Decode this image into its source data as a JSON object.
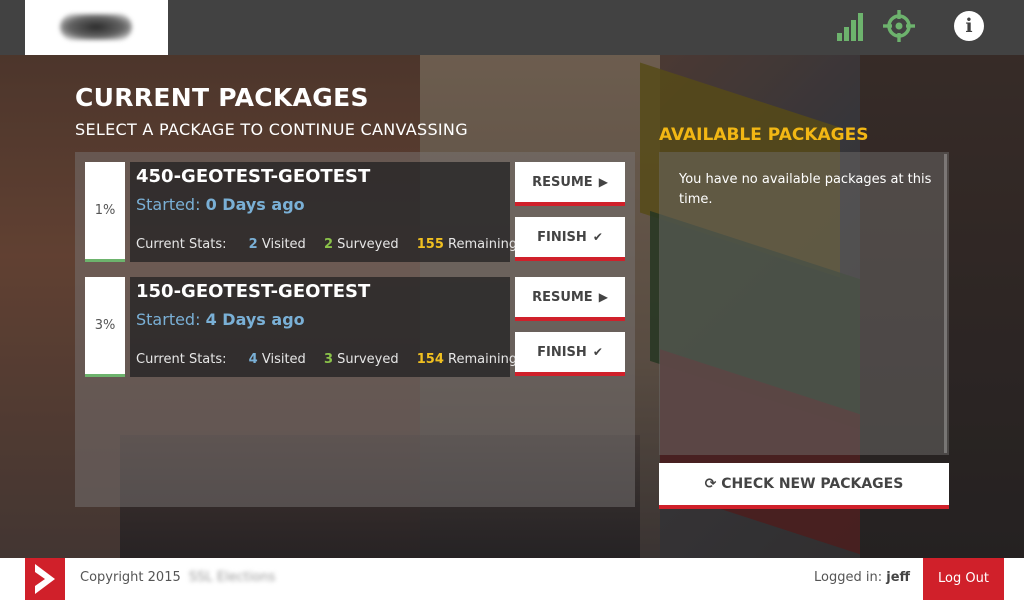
{
  "topbar": {
    "colors": {
      "icon_green": "#6db36d",
      "bar": "#424242"
    },
    "icons": [
      "signal-icon",
      "gps-target-icon",
      "info-icon"
    ]
  },
  "current": {
    "title": "CURRENT PACKAGES",
    "subtitle": "SELECT A PACKAGE TO CONTINUE CANVASSING",
    "stats_label": "Current Stats:",
    "started_label": "Started:",
    "visited_label": "Visited",
    "surveyed_label": "Surveyed",
    "remaining_label": "Remaining",
    "resume_label": "RESUME",
    "finish_label": "FINISH",
    "packages": [
      {
        "progress": "1%",
        "name": "450-GEOTEST-GEOTEST",
        "started": "0 Days ago",
        "visited": "2",
        "surveyed": "2",
        "remaining": "155"
      },
      {
        "progress": "3%",
        "name": "150-GEOTEST-GEOTEST",
        "started": "4 Days ago",
        "visited": "4",
        "surveyed": "3",
        "remaining": "154"
      }
    ]
  },
  "available": {
    "title": "AVAILABLE PACKAGES",
    "message": "You have no available packages at this time.",
    "check_label": "CHECK NEW PACKAGES"
  },
  "footer": {
    "copyright": "Copyright 2015",
    "company": "SSL Elections",
    "logged_label": "Logged in:",
    "user": "jeff",
    "logout_label": "Log Out"
  },
  "colors": {
    "accent_red": "#d0202a",
    "accent_yellow": "#f2b714",
    "blue": "#7ab0d6",
    "green": "#8bc34a"
  }
}
